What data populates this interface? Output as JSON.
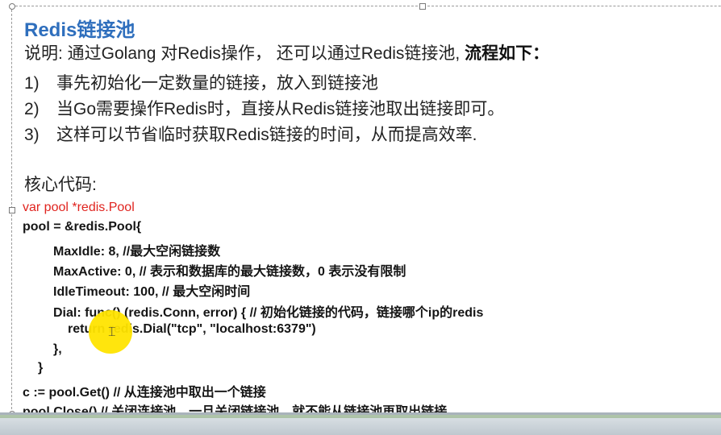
{
  "slide": {
    "title": "Redis链接池",
    "description_prefix": "说明: 通过Golang 对Redis操作， 还可以通过Redis链接池, ",
    "description_bold": "流程如下：",
    "steps": [
      {
        "num": "1)",
        "text": "事先初始化一定数量的链接，放入到链接池"
      },
      {
        "num": "2)",
        "text": "当Go需要操作Redis时，直接从Redis链接池取出链接即可。"
      },
      {
        "num": "3)",
        "text": "这样可以节省临时获取Redis链接的时间，从而提高效率."
      }
    ],
    "section_label": "核心代码:",
    "code": [
      "var pool *redis.Pool",
      "pool = &redis.Pool{",
      "MaxIdle: 8, //最大空闲链接数",
      "MaxActive: 0, // 表示和数据库的最大链接数，0 表示没有限制",
      "IdleTimeout: 100,  // 最大空闲时间",
      "Dial: func() (redis.Conn, error) { // 初始化链接的代码，链接哪个ip的redis",
      "return redis.Dial(\"tcp\", \"localhost:6379\")",
      "},",
      "}",
      "c := pool.Get() // 从连接池中取出一个链接",
      "pool.Close() // 关闭连接池，一旦关闭链接池，就不能从链接池再取出链接."
    ]
  },
  "colors": {
    "title": "#2f6fbd",
    "code_keyword_red": "#e0241f",
    "cursor_highlight": "#ffe400"
  },
  "icons": {
    "cursor": "text-cursor-icon"
  }
}
